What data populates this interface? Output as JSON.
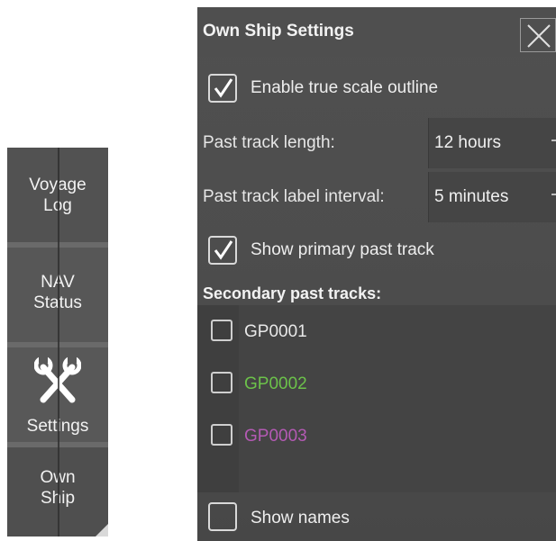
{
  "sidebar": {
    "items": [
      {
        "label": "Voyage\nLog"
      },
      {
        "label": "NAV\nStatus"
      },
      {
        "label": "Settings",
        "icon": "wrench-screwdriver-icon"
      },
      {
        "label": "Own\nShip"
      }
    ]
  },
  "panel": {
    "title": "Own Ship Settings",
    "close_icon": "close-icon",
    "enable_outline": {
      "label": "Enable true scale outline",
      "checked": true
    },
    "past_track_length": {
      "label": "Past track length:",
      "value": "12 hours"
    },
    "past_track_label_interval": {
      "label": "Past track label interval:",
      "value": "5 minutes"
    },
    "show_primary": {
      "label": "Show primary past track",
      "checked": true
    },
    "secondary_title": "Secondary past tracks:",
    "secondary_tracks": [
      {
        "name": "GP0001",
        "color": "#e8e8e8",
        "checked": false
      },
      {
        "name": "GP0002",
        "color": "#6cc24a",
        "checked": false
      },
      {
        "name": "GP0003",
        "color": "#b45ab4",
        "checked": false
      }
    ],
    "show_names": {
      "label": "Show names",
      "checked": false
    }
  }
}
